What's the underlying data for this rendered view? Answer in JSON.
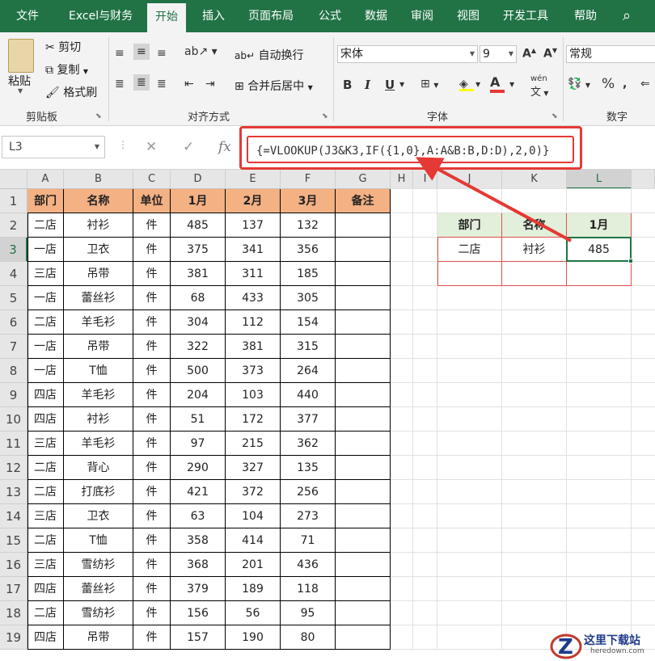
{
  "tabs": [
    {
      "label": "文件",
      "active": false
    },
    {
      "label": "Excel与财务",
      "active": false
    },
    {
      "label": "开始",
      "active": true
    },
    {
      "label": "插入",
      "active": false
    },
    {
      "label": "页面布局",
      "active": false
    },
    {
      "label": "公式",
      "active": false
    },
    {
      "label": "数据",
      "active": false
    },
    {
      "label": "审阅",
      "active": false
    },
    {
      "label": "视图",
      "active": false
    },
    {
      "label": "开发工具",
      "active": false
    },
    {
      "label": "帮助",
      "active": false
    }
  ],
  "ribbon": {
    "clipboard": {
      "paste": "粘贴",
      "cut": "剪切",
      "copy": "复制",
      "format_painter": "格式刷",
      "title": "剪贴板"
    },
    "alignment": {
      "wrap_text": "自动换行",
      "merge_center": "合并后居中",
      "title": "对齐方式"
    },
    "font": {
      "font_name": "宋体",
      "font_size": "9",
      "bold": "B",
      "italic": "I",
      "underline": "U",
      "font_color_letter": "A",
      "phonetic": "wén",
      "title": "字体"
    },
    "number": {
      "format": "常规",
      "percent": "%",
      "title": "数字"
    }
  },
  "formula_bar": {
    "name_box": "L3",
    "fx": "fx",
    "formula": "{=VLOOKUP(J3&K3,IF({1,0},A:A&B:B,D:D),2,0)}"
  },
  "columns": [
    "A",
    "B",
    "C",
    "D",
    "E",
    "F",
    "G",
    "H",
    "I",
    "J",
    "K",
    "L"
  ],
  "selected_column": "L",
  "selected_row": "3",
  "rows": [
    "1",
    "2",
    "3",
    "4",
    "5",
    "6",
    "7",
    "8",
    "9",
    "10",
    "11",
    "12",
    "13",
    "14",
    "15",
    "16",
    "17",
    "18",
    "19"
  ],
  "table": {
    "headers": [
      "部门",
      "名称",
      "单位",
      "1月",
      "2月",
      "3月",
      "备注"
    ],
    "data": [
      [
        "二店",
        "衬衫",
        "件",
        "485",
        "137",
        "132",
        ""
      ],
      [
        "一店",
        "卫衣",
        "件",
        "375",
        "341",
        "356",
        ""
      ],
      [
        "三店",
        "吊带",
        "件",
        "381",
        "311",
        "185",
        ""
      ],
      [
        "一店",
        "蕾丝衫",
        "件",
        "68",
        "433",
        "305",
        ""
      ],
      [
        "二店",
        "羊毛衫",
        "件",
        "304",
        "112",
        "154",
        ""
      ],
      [
        "一店",
        "吊带",
        "件",
        "322",
        "381",
        "315",
        ""
      ],
      [
        "一店",
        "T恤",
        "件",
        "500",
        "373",
        "264",
        ""
      ],
      [
        "四店",
        "羊毛衫",
        "件",
        "204",
        "103",
        "440",
        ""
      ],
      [
        "四店",
        "衬衫",
        "件",
        "51",
        "172",
        "377",
        ""
      ],
      [
        "三店",
        "羊毛衫",
        "件",
        "97",
        "215",
        "362",
        ""
      ],
      [
        "二店",
        "背心",
        "件",
        "290",
        "327",
        "135",
        ""
      ],
      [
        "二店",
        "打底衫",
        "件",
        "421",
        "372",
        "256",
        ""
      ],
      [
        "三店",
        "卫衣",
        "件",
        "63",
        "104",
        "273",
        ""
      ],
      [
        "二店",
        "T恤",
        "件",
        "358",
        "414",
        "71",
        ""
      ],
      [
        "三店",
        "雪纺衫",
        "件",
        "368",
        "201",
        "436",
        ""
      ],
      [
        "四店",
        "蕾丝衫",
        "件",
        "379",
        "189",
        "118",
        ""
      ],
      [
        "二店",
        "雪纺衫",
        "件",
        "156",
        "56",
        "95",
        ""
      ],
      [
        "四店",
        "吊带",
        "件",
        "157",
        "190",
        "80",
        ""
      ]
    ]
  },
  "lookup": {
    "headers": [
      "部门",
      "名称",
      "1月"
    ],
    "row": [
      "二店",
      "衬衫",
      "485"
    ]
  },
  "watermark": {
    "text": "这里下载站",
    "url": "heredown.com"
  },
  "colors": {
    "accent": "#217346",
    "header_fill": "#f4b183",
    "lookup_header_fill": "#e2efda",
    "callout": "#e53935"
  }
}
